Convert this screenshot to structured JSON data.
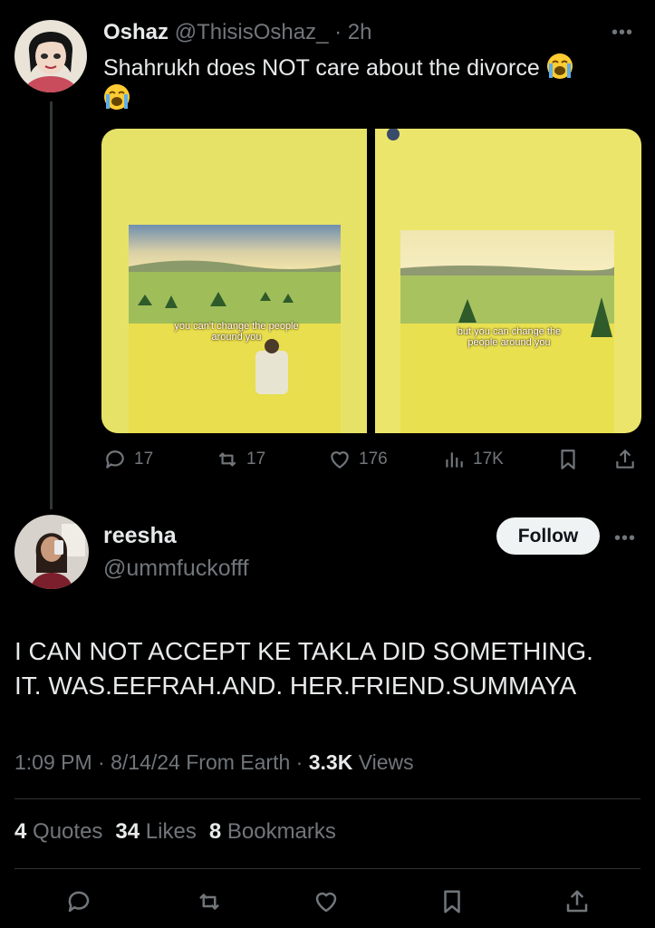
{
  "quoted_tweet": {
    "name": "Oshaz",
    "handle": "@ThisisOshaz_",
    "separator": "·",
    "time": "2h",
    "text": "Shahrukh does NOT care about the divorce",
    "emoji": "loudly-crying-face",
    "media": {
      "left_caption": "you can't change the people around you",
      "right_caption": "but you can change the people around you"
    },
    "actions": {
      "replies": "17",
      "reposts": "17",
      "likes": "176",
      "views": "17K"
    }
  },
  "tweet": {
    "name": "reesha",
    "handle": "@ummfuckofff",
    "follow_label": "Follow",
    "text_line1": "I CAN NOT ACCEPT KE TAKLA DID SOMETHING.",
    "text_line2": "IT. WAS.EEFRAH.AND. HER.FRIEND.SUMMAYA",
    "meta": {
      "time": "1:09 PM",
      "date": "8/14/24",
      "source": "From Earth",
      "views_count": "3.3K",
      "views_label": "Views"
    },
    "stats": {
      "quotes_count": "4",
      "quotes_label": "Quotes",
      "likes_count": "34",
      "likes_label": "Likes",
      "bookmarks_count": "8",
      "bookmarks_label": "Bookmarks"
    }
  },
  "colors": {
    "background": "#000000",
    "text_primary": "#e7e9ea",
    "text_secondary": "#71767b",
    "divider": "#2f3336",
    "follow_bg": "#eff3f4"
  }
}
